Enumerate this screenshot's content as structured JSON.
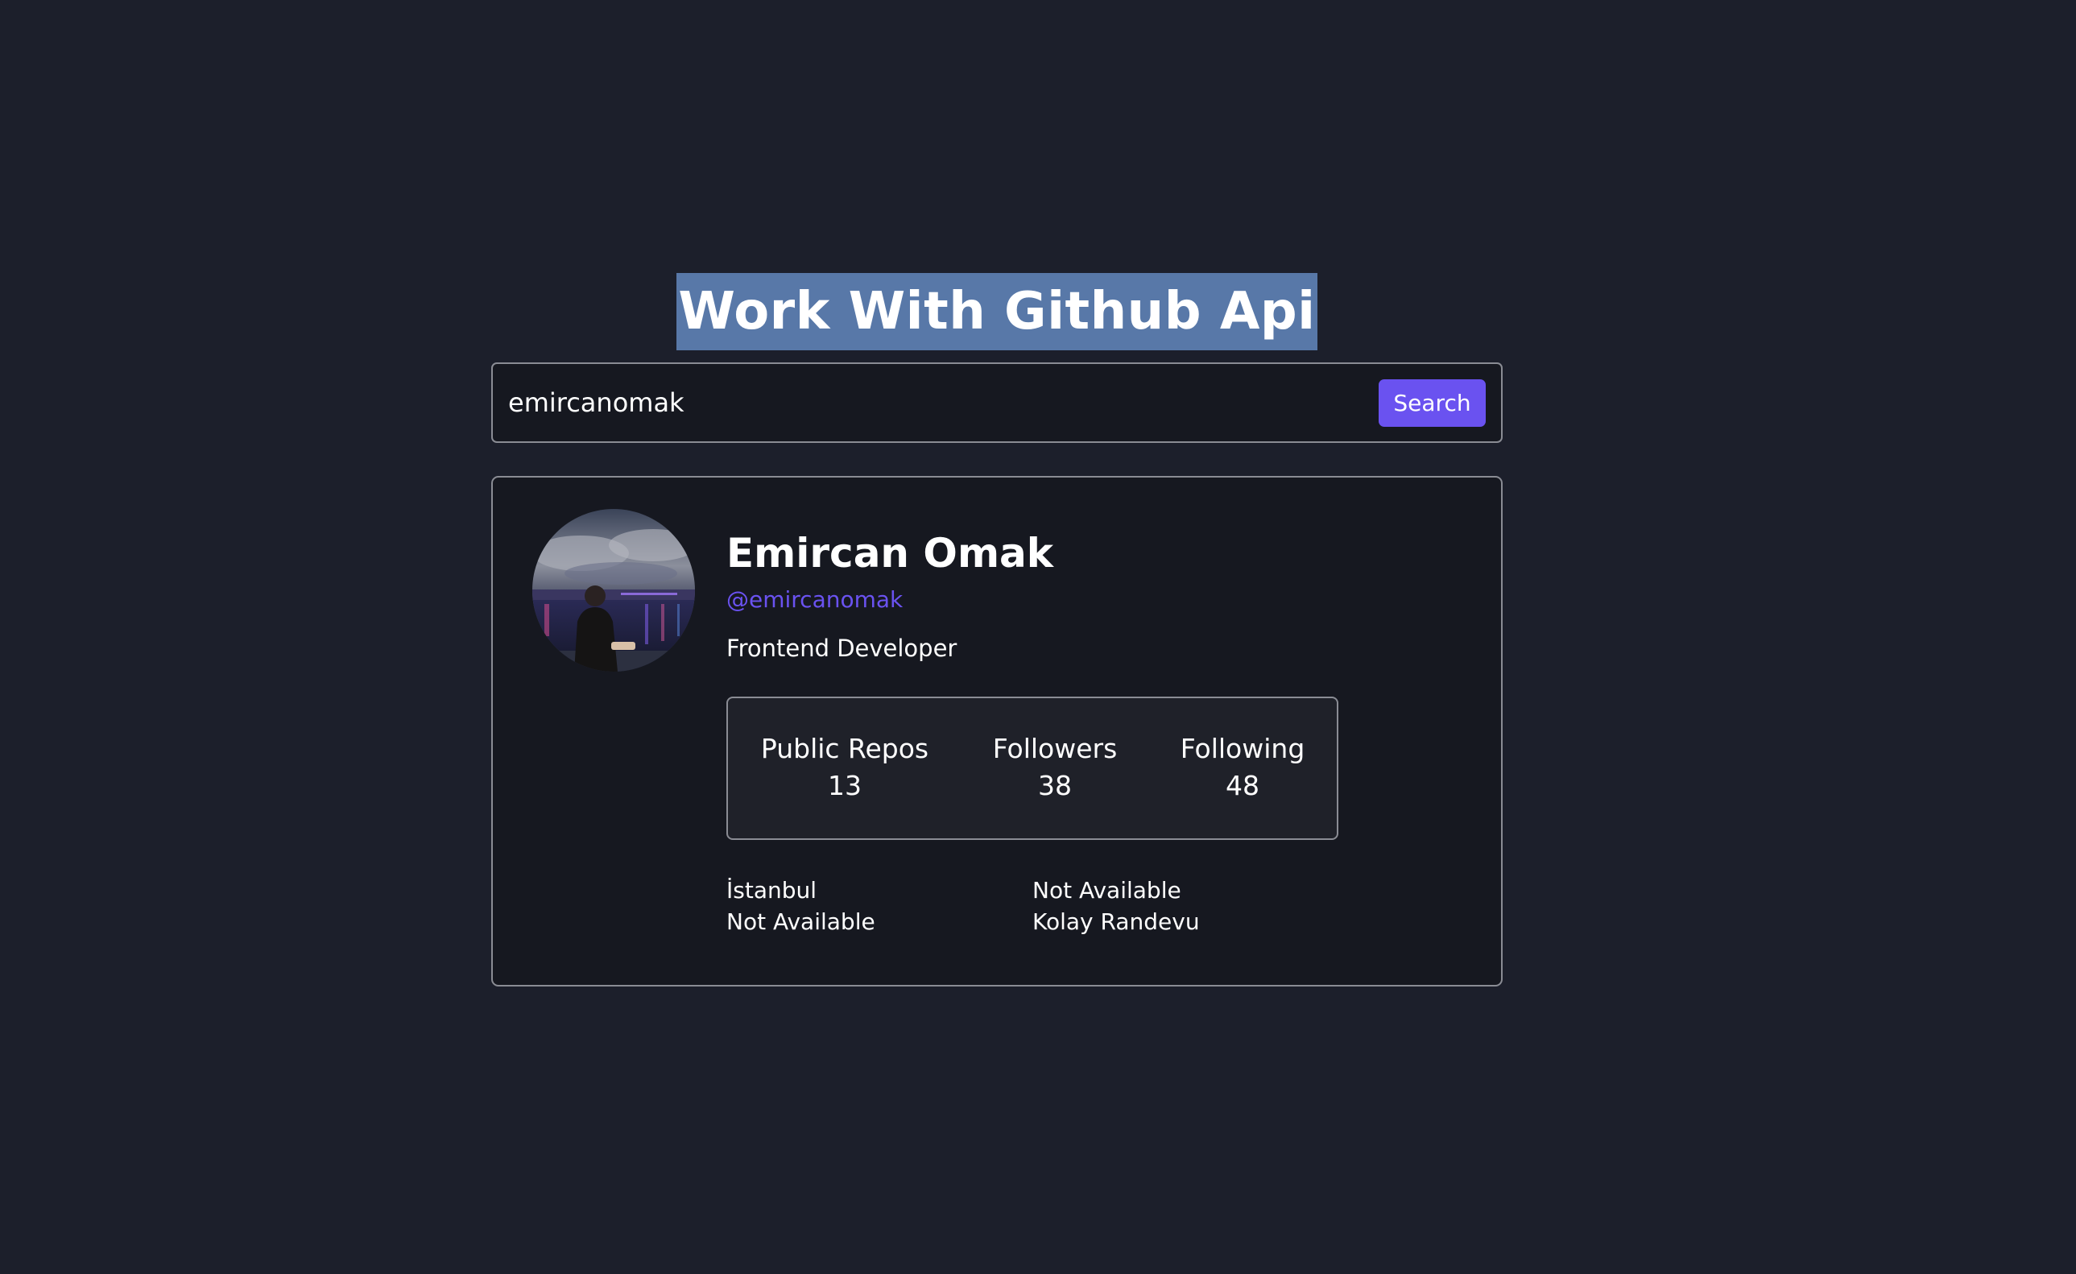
{
  "header": {
    "title": "Work With Github Api"
  },
  "search": {
    "value": "emircanomak",
    "button_label": "Search"
  },
  "profile": {
    "name": "Emircan Omak",
    "login": "@emircanomak",
    "bio": "Frontend Developer",
    "stats": [
      {
        "label": "Public Repos",
        "value": "13"
      },
      {
        "label": "Followers",
        "value": "38"
      },
      {
        "label": "Following",
        "value": "48"
      }
    ],
    "location": "İstanbul",
    "twitter": "Not Available",
    "blog": "Not Available",
    "company": "Kolay Randevu"
  },
  "colors": {
    "background": "#1c1f2b",
    "card_background": "#161820",
    "accent": "#6a52f0",
    "title_highlight": "#5878a8",
    "border": "#8a8c94"
  }
}
